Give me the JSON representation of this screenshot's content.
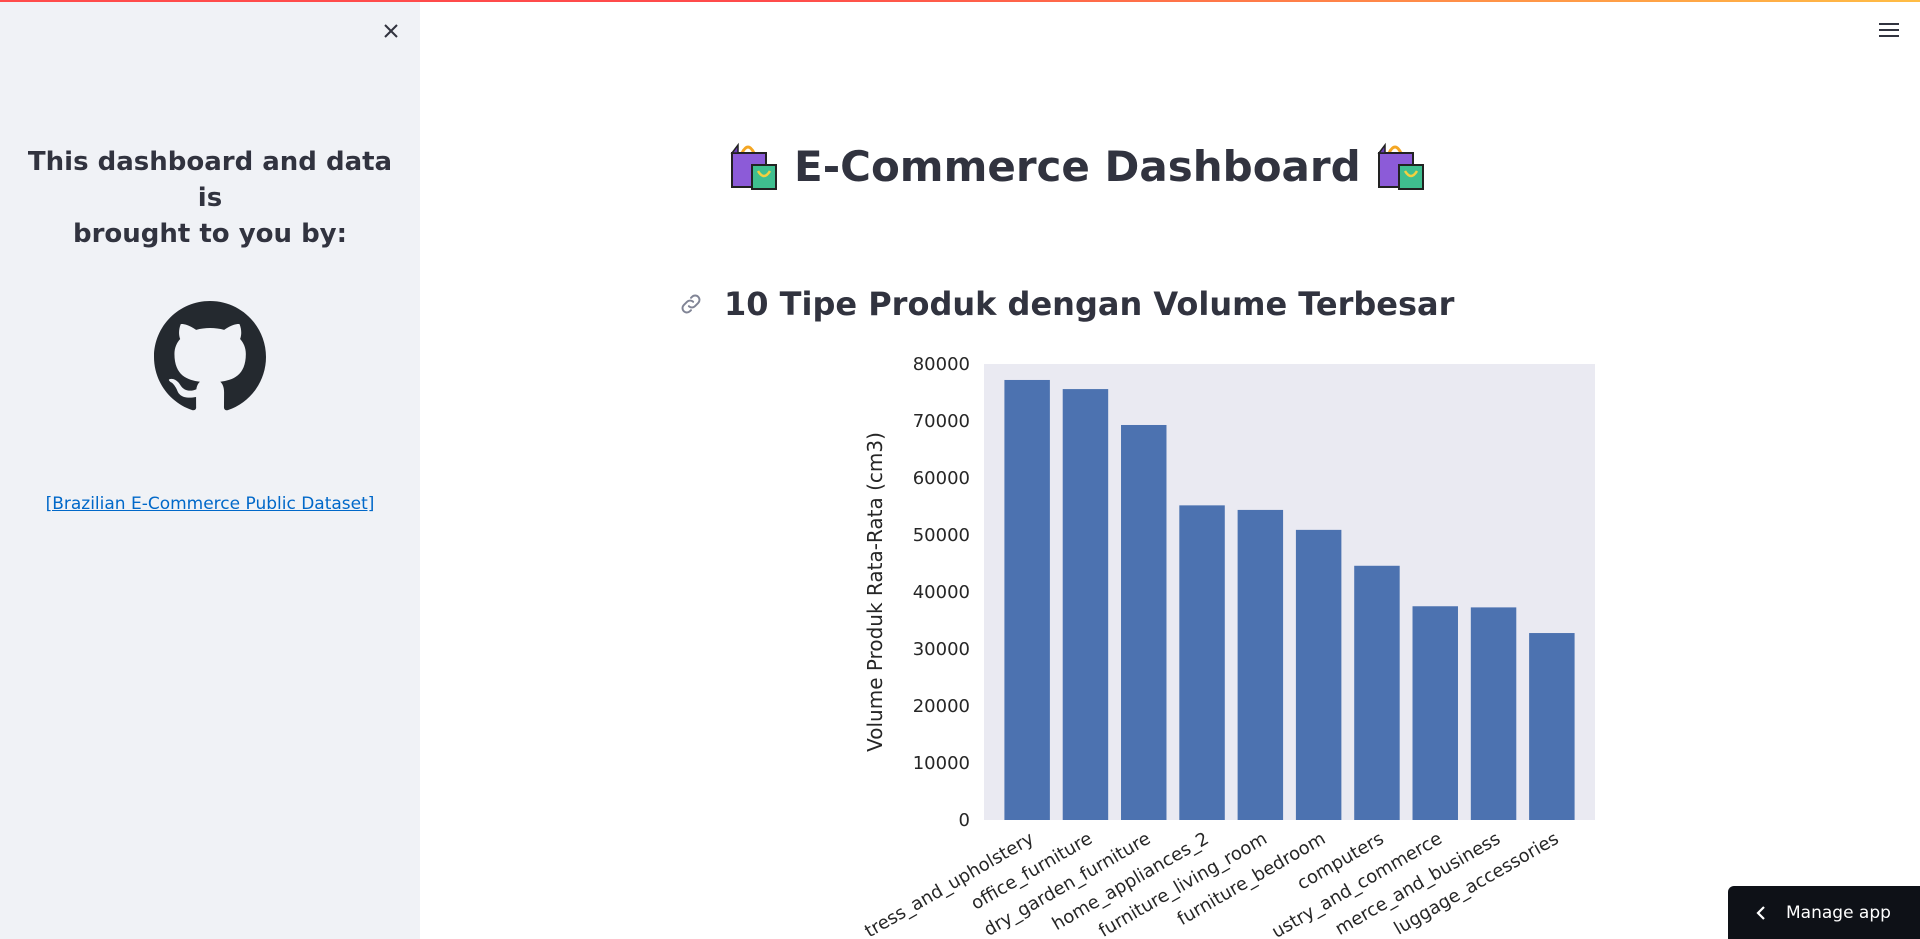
{
  "sidebar": {
    "heading_line1": "This dashboard and data is",
    "heading_line2": "brought to you by:",
    "logo_icon": "github-icon",
    "link_text": "[Brazilian E-Commerce Public Dataset]",
    "close_icon": "close-icon"
  },
  "header": {
    "menu_icon": "hamburger-menu-icon"
  },
  "main": {
    "title": "E-Commerce Dashboard",
    "title_icon": "shopping-bags-emoji",
    "section_title": "10 Tipe Produk dengan Volume Terbesar",
    "section_icon": "link-icon"
  },
  "manage_app": {
    "label": "Manage app",
    "icon": "chevron-left-icon"
  },
  "colors": {
    "bar": "#4c72b0",
    "plot_bg": "#eaeaf2",
    "sidebar_bg": "#f0f2f6",
    "link": "#0068c9",
    "text": "#31333f",
    "manage_bg": "#0e1117"
  },
  "chart_data": {
    "type": "bar",
    "categories": [
      "bed_bath_mattress_and_upholstery",
      "office_furniture",
      "laundry_garden_furniture",
      "home_appliances_2",
      "furniture_living_room",
      "furniture_bedroom",
      "computers",
      "industry_and_commerce",
      "ecommerce_and_business",
      "luggage_accessories"
    ],
    "tick_labels": [
      "tress_and_upholstery",
      "office_furniture",
      "dry_garden_furniture",
      "home_appliances_2",
      "furniture_living_room",
      "furniture_bedroom",
      "computers",
      "ustry_and_commerce",
      "merce_and_business",
      "luggage_accessories"
    ],
    "values": [
      77200,
      75600,
      69300,
      55200,
      54400,
      50900,
      44600,
      37500,
      37300,
      32800
    ],
    "xlabel": "",
    "ylabel": "Volume Produk Rata-Rata (cm3)",
    "ylim": [
      0,
      80000
    ],
    "yticks": [
      0,
      10000,
      20000,
      30000,
      40000,
      50000,
      60000,
      70000,
      80000
    ],
    "grid": false
  }
}
